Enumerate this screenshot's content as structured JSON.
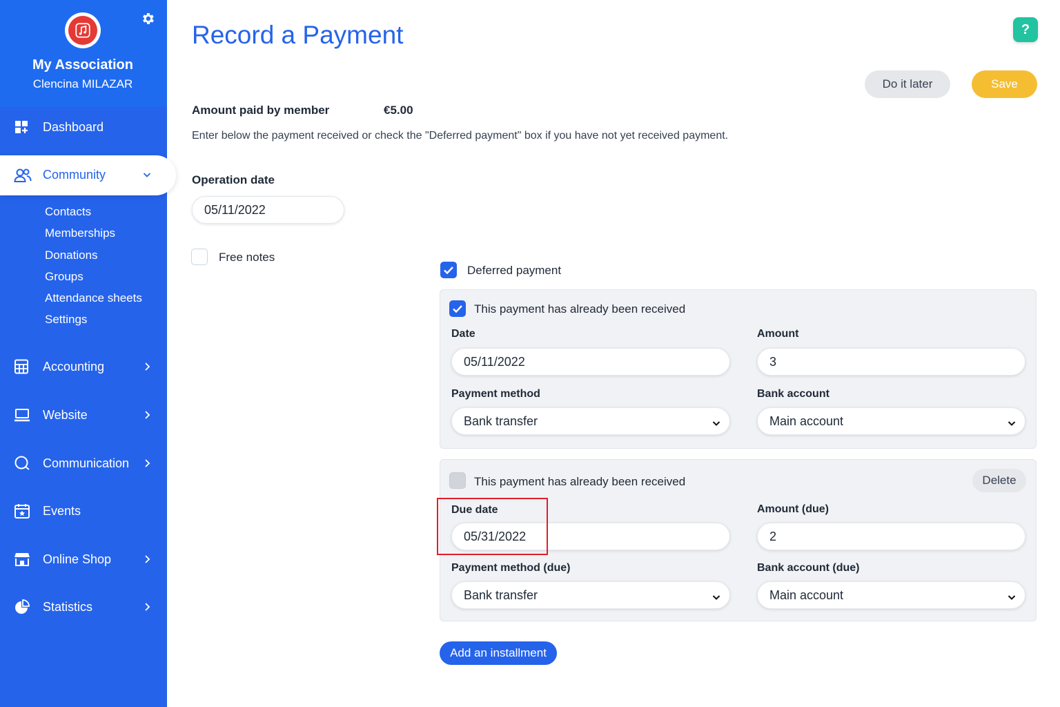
{
  "sidebar": {
    "association_name": "My Association",
    "user_name": "Clencina MILAZAR",
    "nav": {
      "dashboard": "Dashboard",
      "community": "Community",
      "accounting": "Accounting",
      "website": "Website",
      "communication": "Communication",
      "events": "Events",
      "online_shop": "Online Shop",
      "statistics": "Statistics"
    },
    "community_sub": [
      "Contacts",
      "Memberships",
      "Donations",
      "Groups",
      "Attendance sheets",
      "Settings"
    ]
  },
  "header": {
    "title": "Record a Payment",
    "help_label": "?",
    "do_it_later": "Do it later",
    "save": "Save"
  },
  "summary": {
    "amount_label": "Amount paid by member",
    "amount_value": "€5.00",
    "instructions": "Enter below the payment received or check the \"Deferred payment\" box if you have not yet received payment."
  },
  "operation": {
    "label": "Operation date",
    "value": "05/11/2022"
  },
  "free_notes": {
    "label": "Free notes",
    "checked": false
  },
  "deferred": {
    "label": "Deferred payment",
    "checked": true
  },
  "installment1": {
    "received_label": "This payment has already been received",
    "received_checked": true,
    "date_label": "Date",
    "date_value": "05/11/2022",
    "amount_label": "Amount",
    "amount_value": "3",
    "method_label": "Payment method",
    "method_value": "Bank transfer",
    "bank_label": "Bank account",
    "bank_value": "Main account"
  },
  "installment2": {
    "received_label": "This payment has already been received",
    "received_checked": false,
    "delete_label": "Delete",
    "date_label": "Due date",
    "date_value": "05/31/2022",
    "amount_label": "Amount (due)",
    "amount_value": "2",
    "method_label": "Payment method (due)",
    "method_value": "Bank transfer",
    "bank_label": "Bank account (due)",
    "bank_value": "Main account"
  },
  "add_installment": "Add an installment",
  "colors": {
    "sidebar": "#2563eb",
    "accent": "#2563eb",
    "save": "#f5be32",
    "help": "#22c3a0",
    "highlight": "#e11d2b"
  }
}
